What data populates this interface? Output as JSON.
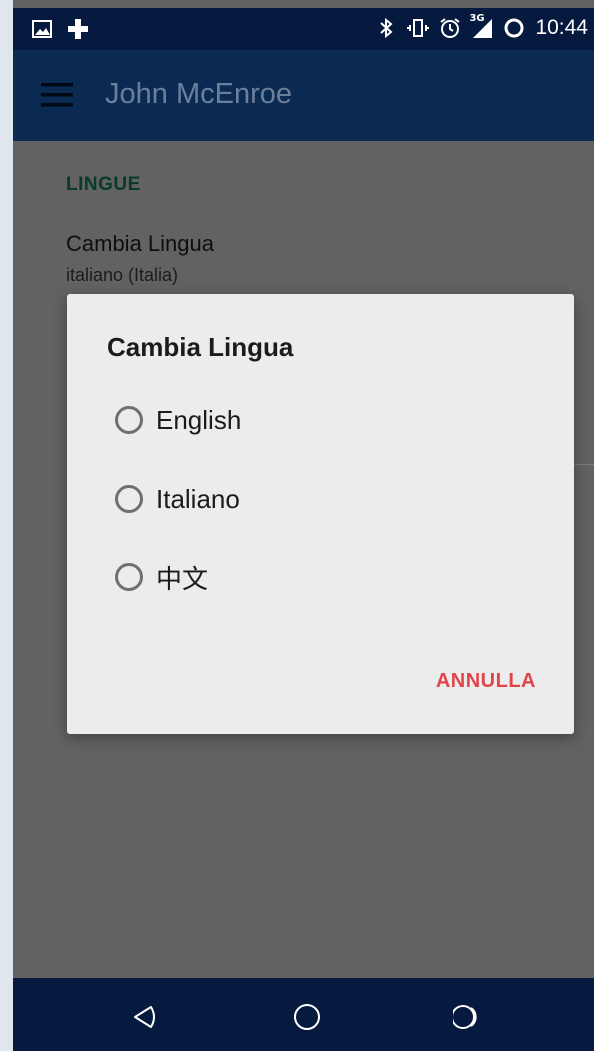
{
  "status_bar": {
    "time": "10:44",
    "network": "3G",
    "icons": [
      "image-notification-icon",
      "health-cross-icon",
      "bluetooth-icon",
      "vibrate-icon",
      "alarm-icon",
      "signal-icon",
      "battery-ring-icon"
    ]
  },
  "app_bar": {
    "title": "John McEnroe",
    "menu_icon": "hamburger-menu-icon"
  },
  "settings": {
    "section_header": "LINGUE",
    "language_pref_title": "Cambia Lingua",
    "language_pref_summary": "italiano (Italia)"
  },
  "dialog": {
    "title": "Cambia Lingua",
    "options": [
      "English",
      "Italiano",
      "中文"
    ],
    "cancel_label": "ANNULLA"
  },
  "nav_bar": {
    "icons": [
      "back-icon",
      "home-icon",
      "recents-icon"
    ]
  },
  "colors": {
    "status_bar_bg": "#051a3e",
    "app_bar_bg": "#0b2a52",
    "scrim": "#626262",
    "dialog_bg": "#ececec",
    "accent_section": "#0a3a2b",
    "cancel_accent": "#e0454b"
  }
}
